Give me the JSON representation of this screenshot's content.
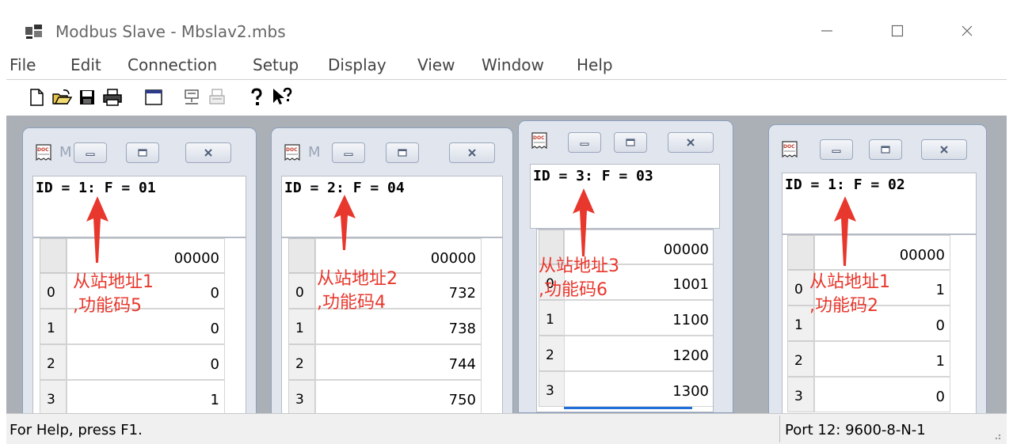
{
  "window": {
    "title": "Modbus Slave - Mbslav2.mbs"
  },
  "menu": [
    "File",
    "Edit",
    "Connection",
    "Setup",
    "Display",
    "View",
    "Window",
    "Help"
  ],
  "toolbar": [
    "new-icon",
    "open-icon",
    "save-icon",
    "print-icon",
    "window-icon",
    "connect-icon",
    "disconnect-icon",
    "about-icon",
    "context-help-icon"
  ],
  "children": [
    {
      "caption": "M",
      "header": "ID = 1: F = 01",
      "column": "00000",
      "rows": [
        {
          "index": "0",
          "value": "0"
        },
        {
          "index": "1",
          "value": "0"
        },
        {
          "index": "2",
          "value": "0"
        },
        {
          "index": "3",
          "value": "1"
        }
      ],
      "annotation": [
        "从站地址1",
        ",功能码5"
      ]
    },
    {
      "caption": "M",
      "header": "ID = 2: F = 04",
      "column": "00000",
      "rows": [
        {
          "index": "0",
          "value": "732"
        },
        {
          "index": "1",
          "value": "738"
        },
        {
          "index": "2",
          "value": "744"
        },
        {
          "index": "3",
          "value": "750"
        }
      ],
      "annotation": [
        "从站地址2",
        ",功能码4"
      ]
    },
    {
      "caption": "",
      "header": "ID = 3: F = 03",
      "column": "00000",
      "rows": [
        {
          "index": "0",
          "value": "1001"
        },
        {
          "index": "1",
          "value": "1100"
        },
        {
          "index": "2",
          "value": "1200"
        },
        {
          "index": "3",
          "value": "1300"
        }
      ],
      "annotation": [
        "从站地址3",
        ",功能码6"
      ]
    },
    {
      "caption": "",
      "header": "ID = 1: F = 02",
      "column": "00000",
      "rows": [
        {
          "index": "0",
          "value": "1"
        },
        {
          "index": "1",
          "value": "0"
        },
        {
          "index": "2",
          "value": "1"
        },
        {
          "index": "3",
          "value": "0"
        }
      ],
      "annotation": [
        "从站地址1",
        ",功能码2"
      ]
    }
  ],
  "status": {
    "help": "For Help, press F1.",
    "port": "Port 12: 9600-8-N-1"
  },
  "colors": {
    "annotation": "#e8372c",
    "mdi_background": "#abb0b6"
  }
}
